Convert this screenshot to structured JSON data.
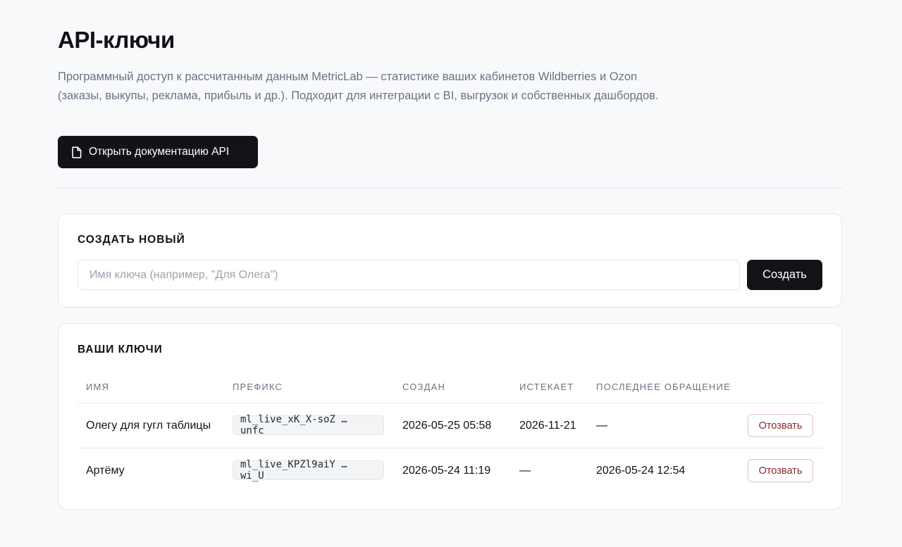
{
  "header": {
    "title": "API-ключи",
    "description": "Программный доступ к рассчитанным данным MetricLab — статистике ваших кабинетов Wildberries и Ozon (заказы, выкупы, реклама, прибыль и др.). Подходит для интеграции с BI, выгрузок и собственных дашбордов.",
    "docs_button_label": "Открыть документацию API",
    "docs_button_icon": "document-icon"
  },
  "create": {
    "title": "СОЗДАТЬ НОВЫЙ",
    "input_value": "",
    "input_placeholder": "Имя ключа (например, \"Для Олега\")",
    "button_label": "Создать"
  },
  "keys": {
    "title": "ВАШИ КЛЮЧИ",
    "columns": [
      "ИМЯ",
      "ПРЕФИКС",
      "СОЗДАН",
      "ИСТЕКАЕТ",
      "ПОСЛЕДНЕЕ ОБРАЩЕНИЕ"
    ],
    "rows": [
      {
        "name": "Олегу для гугл таблицы",
        "prefix": "ml_live_xK_X-soZ … unfc",
        "created": "2026-05-25 05:58",
        "expires": "2026-11-21",
        "last_access": "—",
        "action": "Отозвать"
      },
      {
        "name": "Артёму",
        "prefix": "ml_live_KPZl9aiY … wi_U",
        "created": "2026-05-24 11:19",
        "expires": "—",
        "last_access": "2026-05-24 12:54",
        "action": "Отозвать"
      }
    ]
  },
  "colors": {
    "background": "#f8f9fb",
    "primary_button": "#121317",
    "revoke_text": "#8b2a2a",
    "muted_text": "#6b7280"
  }
}
